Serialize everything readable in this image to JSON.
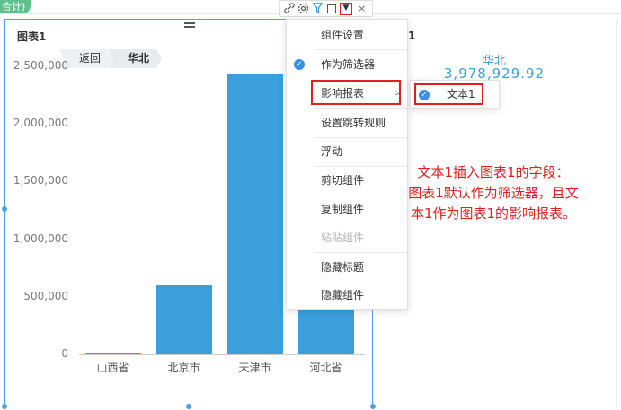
{
  "top_tag": "合计)",
  "chart": {
    "title": "图表1",
    "breadcrumb": {
      "back": "返回",
      "current": "华北"
    },
    "chart_data": {
      "type": "bar",
      "title": "图表1",
      "categories": [
        "山西省",
        "北京市",
        "天津市",
        "河北省"
      ],
      "values": [
        15000,
        600000,
        2430000,
        935000
      ],
      "yticks": [
        "2,500,000",
        "2,000,000",
        "1,500,000",
        "1,000,000",
        "500,000",
        "0"
      ],
      "ylim": [
        0,
        2500000
      ],
      "color": "#3a9fdb",
      "grid": false
    }
  },
  "toolbar": {
    "icons": [
      "link-icon",
      "gear-icon",
      "filter-icon",
      "square-icon",
      "dropdown-icon",
      "close-icon"
    ],
    "dropdown_glyph": "▼",
    "close_glyph": "×"
  },
  "menu": {
    "items": [
      {
        "label": "组件设置",
        "checked": false,
        "disabled": false
      },
      {
        "label": "作为筛选器",
        "checked": true,
        "disabled": false
      },
      {
        "label": "影响报表",
        "checked": false,
        "disabled": false,
        "submenu": true
      },
      {
        "label": "设置跳转规则",
        "checked": false,
        "disabled": false
      },
      {
        "label": "浮动",
        "checked": false,
        "disabled": false
      },
      {
        "label": "剪切组件",
        "checked": false,
        "disabled": false
      },
      {
        "label": "复制组件",
        "checked": false,
        "disabled": false
      },
      {
        "label": "粘贴组件",
        "checked": false,
        "disabled": true
      },
      {
        "label": "隐藏标题",
        "checked": false,
        "disabled": false
      },
      {
        "label": "隐藏组件",
        "checked": false,
        "disabled": false
      }
    ],
    "submenu_arrow": ">"
  },
  "submenu": {
    "item_label": "文本1",
    "checked": true
  },
  "text_component": {
    "title": "1",
    "label": "华北",
    "value": "3,978,929.92"
  },
  "annotation": {
    "line1": "文本1插入图表1的字段：",
    "line2": "图表1默认作为筛选器，且文",
    "line3": "本1作为图表1的影响报表。"
  },
  "colors": {
    "accent": "#3a9fdb",
    "highlight": "#e02020",
    "check": "#3a8ee6"
  }
}
